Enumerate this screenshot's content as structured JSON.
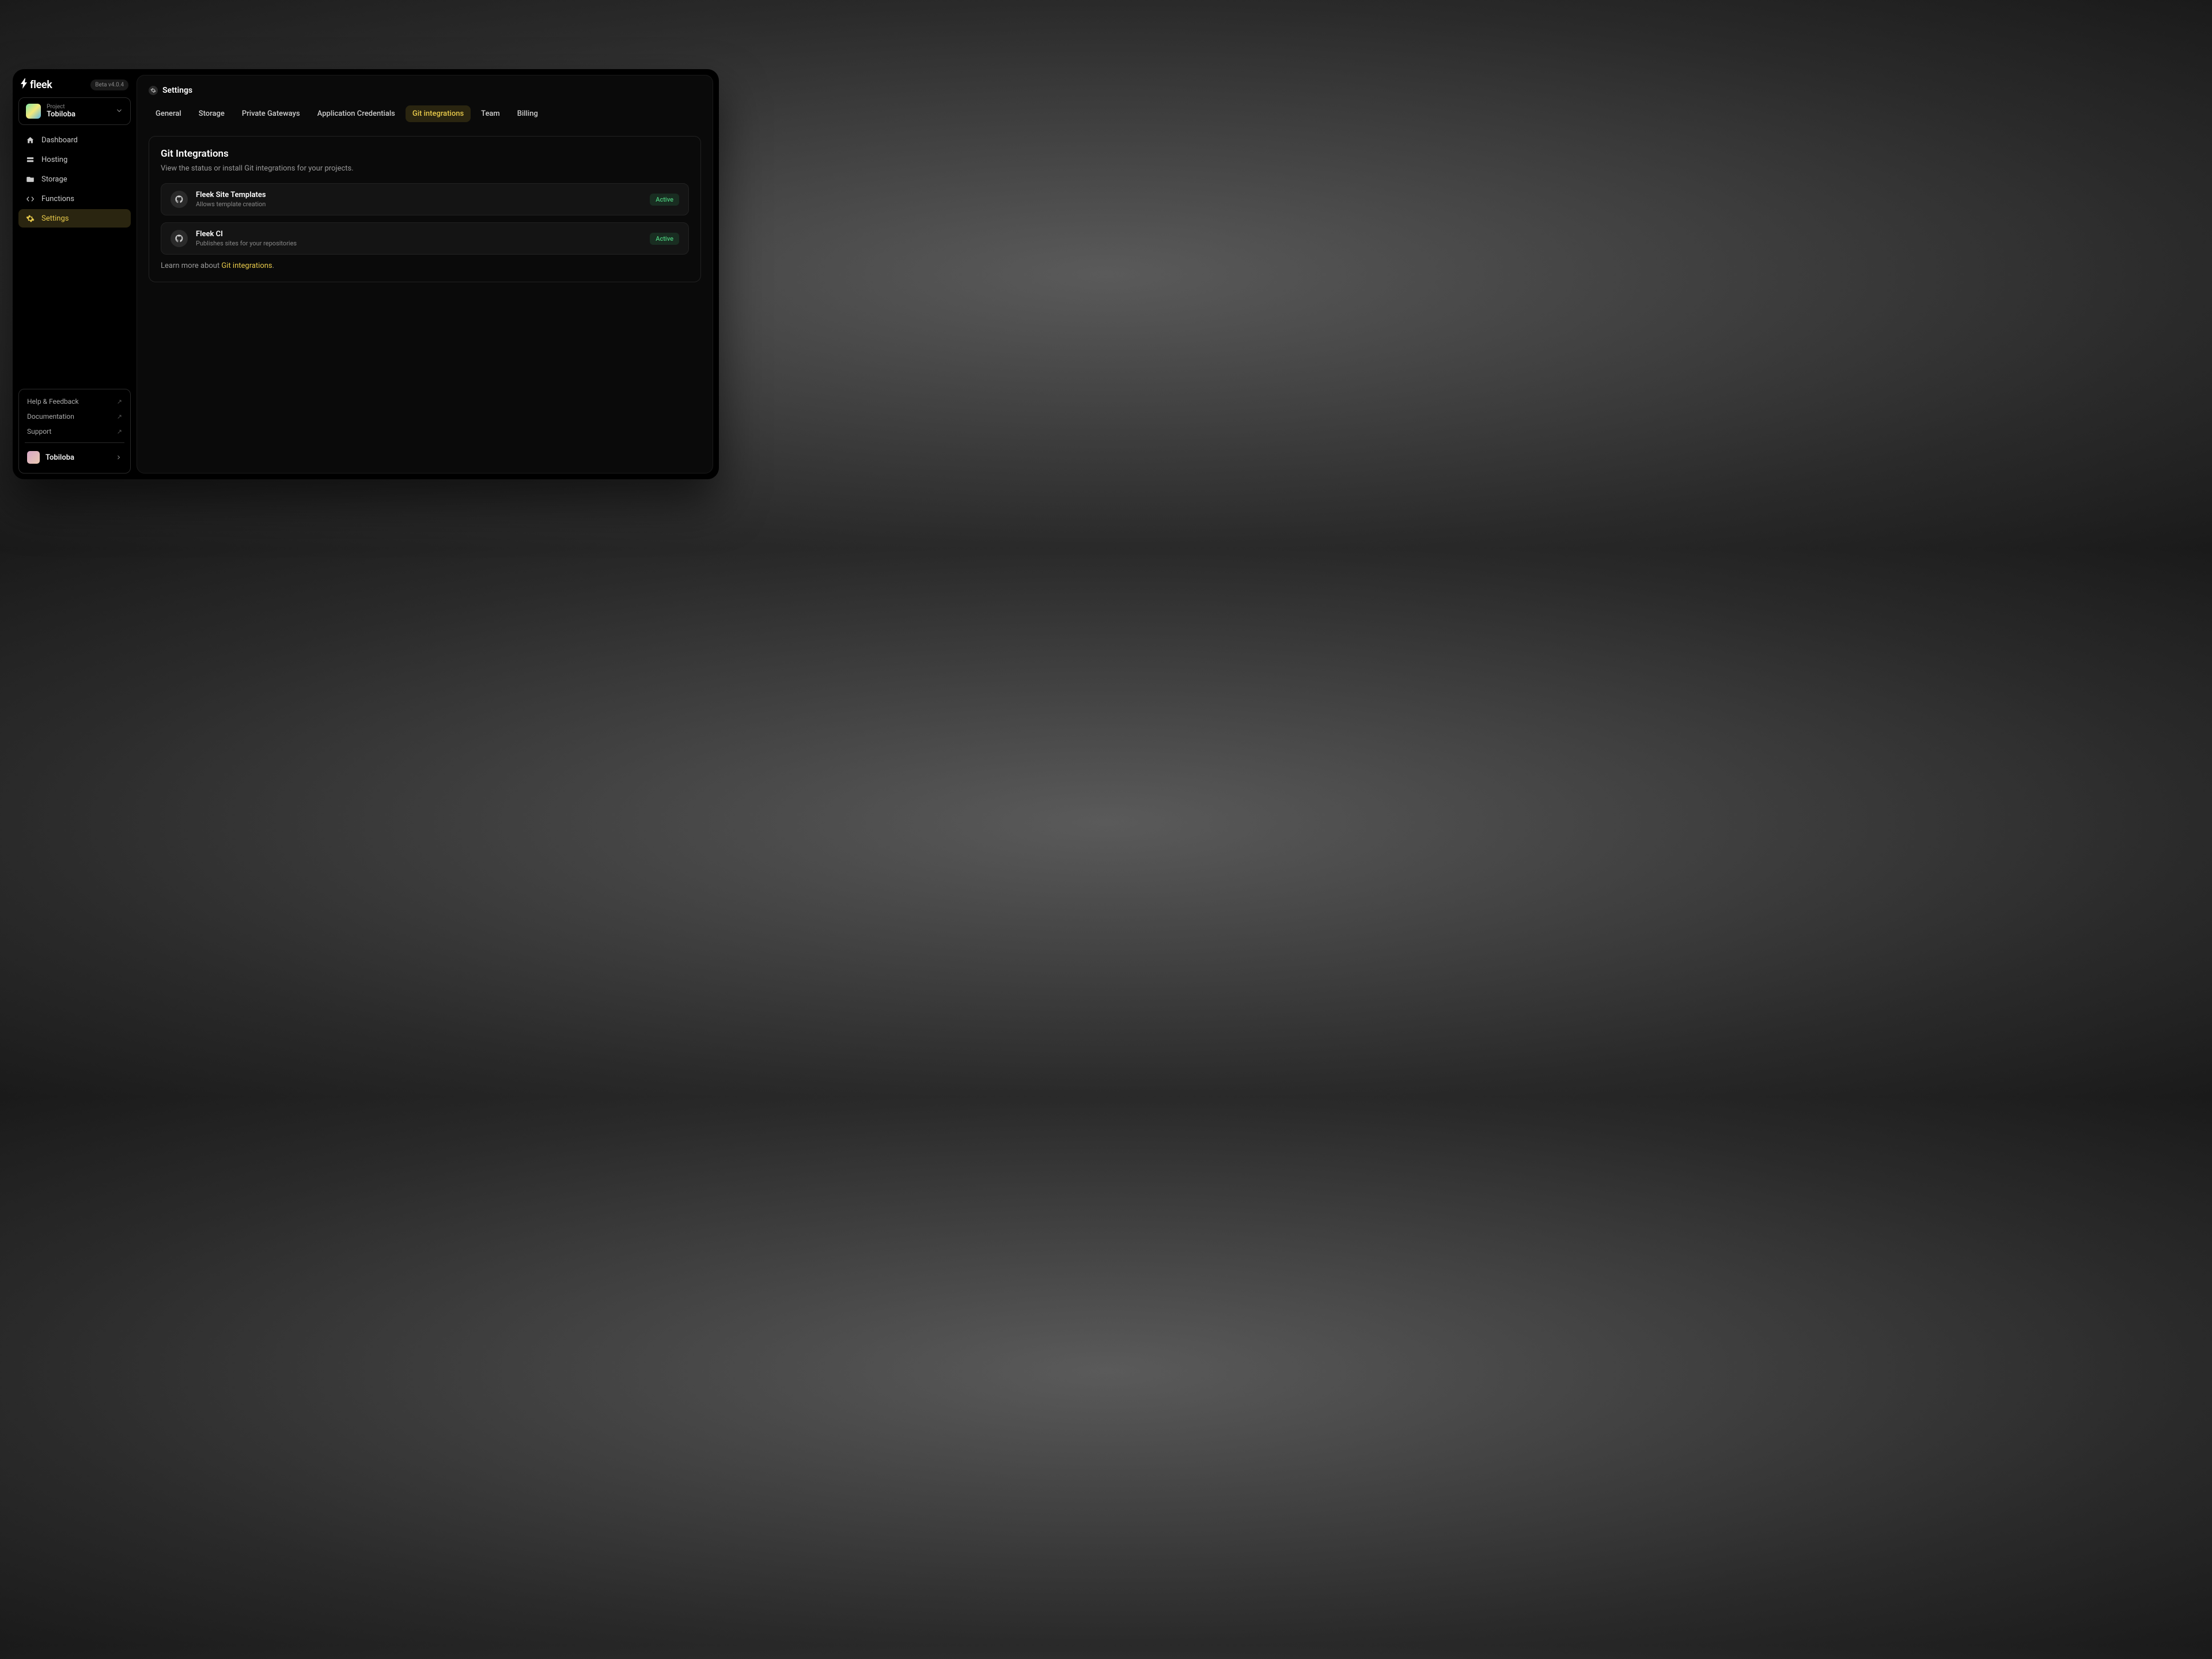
{
  "logo": {
    "text": "fleek"
  },
  "version_badge": "Beta v4.0.4",
  "project_selector": {
    "label": "Project",
    "name": "Tobiloba"
  },
  "nav": {
    "dashboard": "Dashboard",
    "hosting": "Hosting",
    "storage": "Storage",
    "functions": "Functions",
    "settings": "Settings"
  },
  "footer": {
    "help": "Help & Feedback",
    "docs": "Documentation",
    "support": "Support",
    "user": "Tobiloba"
  },
  "breadcrumb": "Settings",
  "tabs": {
    "general": "General",
    "storage": "Storage",
    "gateways": "Private Gateways",
    "credentials": "Application Credentials",
    "git": "Git integrations",
    "team": "Team",
    "billing": "Billing"
  },
  "card": {
    "title": "Git Integrations",
    "subtitle": "View the status or install Git integrations for your projects.",
    "learn_prefix": "Learn more about ",
    "learn_link": "Git integrations",
    "learn_suffix": "."
  },
  "integrations": [
    {
      "name": "Fleek Site Templates",
      "desc": "Allows template creation",
      "status": "Active"
    },
    {
      "name": "Fleek CI",
      "desc": "Publishes sites for your repositories",
      "status": "Active"
    }
  ]
}
